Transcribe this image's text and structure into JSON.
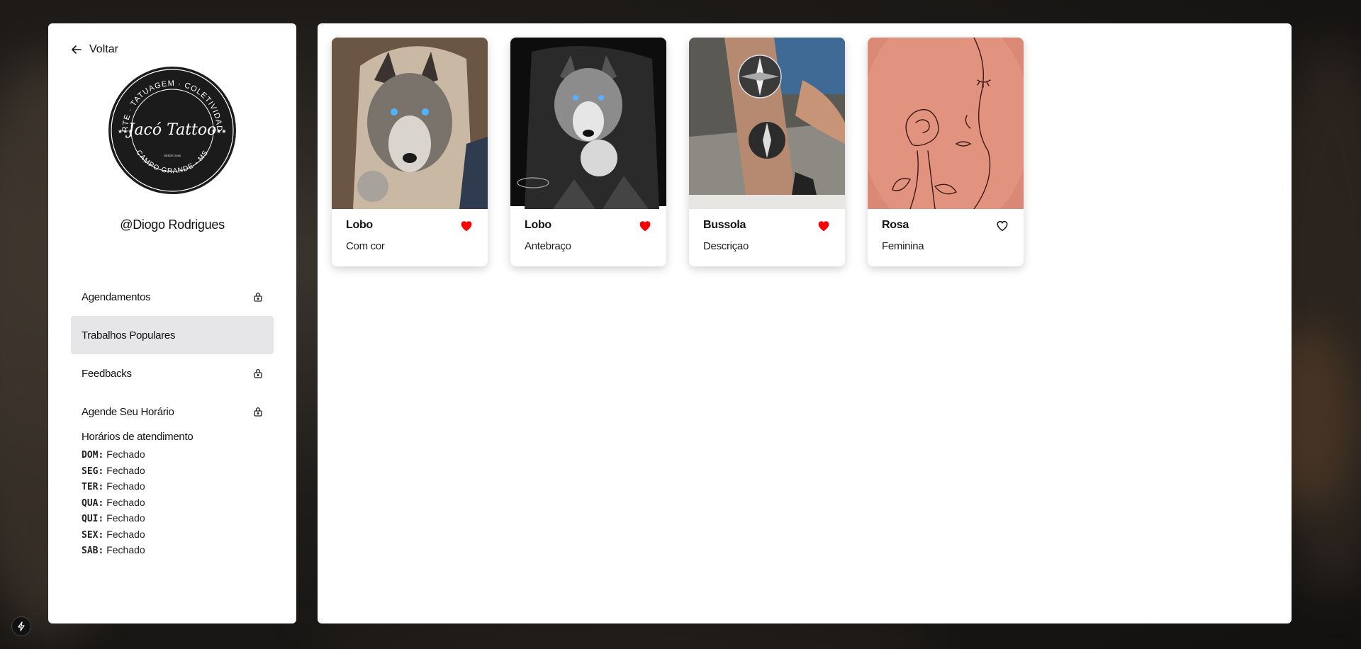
{
  "sidebar": {
    "back_label": "Voltar",
    "logo": {
      "top_text": "ARTE · TATUAGEM · COLETIVIDADE",
      "center_text": "Jacó Tattoo",
      "since_text": "DESDE 2016",
      "bottom_text": "CAMPO GRANDE - MS"
    },
    "username": "@Diogo Rodrigues",
    "nav": [
      {
        "label": "Agendamentos",
        "locked": true,
        "active": false
      },
      {
        "label": "Trabalhos Populares",
        "locked": false,
        "active": true
      },
      {
        "label": "Feedbacks",
        "locked": true,
        "active": false
      },
      {
        "label": "Agende Seu Horário",
        "locked": true,
        "active": false
      }
    ],
    "hours": {
      "title": "Horários de atendimento",
      "rows": [
        {
          "day": "DOM:",
          "status": "Fechado"
        },
        {
          "day": "SEG:",
          "status": "Fechado"
        },
        {
          "day": "TER:",
          "status": "Fechado"
        },
        {
          "day": "QUA:",
          "status": "Fechado"
        },
        {
          "day": "QUI:",
          "status": "Fechado"
        },
        {
          "day": "SEX:",
          "status": "Fechado"
        },
        {
          "day": "SAB:",
          "status": "Fechado"
        }
      ]
    }
  },
  "cards": [
    {
      "title": "Lobo",
      "subtitle": "Com cor",
      "liked": true,
      "image": "wolf-tattoo-forearm"
    },
    {
      "title": "Lobo",
      "subtitle": "Antebraço",
      "liked": true,
      "image": "wolf-moon-tattoo-sleeve"
    },
    {
      "title": "Bussola",
      "subtitle": "Descriçao",
      "liked": true,
      "image": "compass-tattoo-arm"
    },
    {
      "title": "Rosa",
      "subtitle": "Feminina",
      "liked": false,
      "image": "rose-face-line-tattoo"
    }
  ],
  "colors": {
    "heart_active": "#ff0000",
    "nav_active_bg": "#e6e6e9"
  }
}
